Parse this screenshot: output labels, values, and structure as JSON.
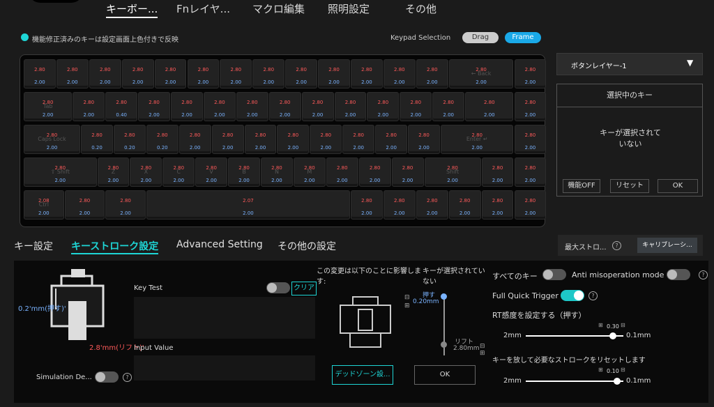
{
  "tabs": [
    "キーボー...",
    "Fnレイヤ...",
    "マクロ編集",
    "照明設定",
    "その他"
  ],
  "notice": "機能修正済みのキーは設定画面上色付きで反映",
  "keypad_selection": {
    "label": "Keypad Selection",
    "drag": "Drag",
    "frame": "Frame"
  },
  "keys": {
    "rows": [
      [
        {
          "a": "2.80",
          "b": "2.00"
        },
        {
          "a": "2.80",
          "b": "2.00"
        },
        {
          "a": "2.80",
          "b": "2.00"
        },
        {
          "a": "2.80",
          "b": "2.00"
        },
        {
          "a": "2.80",
          "b": "2.00"
        },
        {
          "a": "2.80",
          "b": "2.00"
        },
        {
          "a": "2.80",
          "b": "2.00"
        },
        {
          "a": "2.80",
          "b": "2.00"
        },
        {
          "a": "2.80",
          "b": "2.00"
        },
        {
          "a": "2.80",
          "b": "2.00"
        },
        {
          "a": "2.80",
          "b": "2.00"
        },
        {
          "a": "2.80",
          "b": "2.00"
        },
        {
          "a": "2.80",
          "b": "2.00"
        },
        {
          "a": "2.80",
          "b": "2.00",
          "l": "← Back"
        },
        {
          "a": "2.80",
          "b": "2.00"
        }
      ],
      [
        {
          "a": "2.80",
          "b": "2.00",
          "l": "Tab"
        },
        {
          "a": "2.80",
          "b": "2.00"
        },
        {
          "a": "2.80",
          "b": "0.40"
        },
        {
          "a": "2.80",
          "b": "2.00"
        },
        {
          "a": "2.80",
          "b": "2.00"
        },
        {
          "a": "2.80",
          "b": "2.00"
        },
        {
          "a": "2.80",
          "b": "2.00"
        },
        {
          "a": "2.80",
          "b": "2.00"
        },
        {
          "a": "2.80",
          "b": "2.00"
        },
        {
          "a": "2.80",
          "b": "2.00"
        },
        {
          "a": "2.80",
          "b": "2.00"
        },
        {
          "a": "2.80",
          "b": "2.00"
        },
        {
          "a": "2.80",
          "b": "2.00"
        },
        {
          "a": "2.80",
          "b": "2.00"
        },
        {
          "a": "2.80",
          "b": "2.00"
        }
      ],
      [
        {
          "a": "2.80",
          "b": "2.00",
          "l": "Caps Lock"
        },
        {
          "a": "2.80",
          "b": "0.20"
        },
        {
          "a": "2.80",
          "b": "0.20"
        },
        {
          "a": "2.80",
          "b": "0.20"
        },
        {
          "a": "2.80",
          "b": "2.00"
        },
        {
          "a": "2.80",
          "b": "2.00"
        },
        {
          "a": "2.80",
          "b": "2.00"
        },
        {
          "a": "2.80",
          "b": "2.00"
        },
        {
          "a": "2.80",
          "b": "2.00"
        },
        {
          "a": "2.80",
          "b": "2.00"
        },
        {
          "a": "2.80",
          "b": "2.00"
        },
        {
          "a": "2.80",
          "b": "2.00"
        },
        {
          "a": "2.80",
          "b": "2.00",
          "l": "Enter ↵"
        },
        {
          "a": "2.80",
          "b": "2.00"
        }
      ],
      [
        {
          "a": "2.80",
          "b": "2.00",
          "l": "⇧ Shift"
        },
        {
          "a": "2.80",
          "b": "2.00",
          "l": "Z"
        },
        {
          "a": "2.80",
          "b": "2.00",
          "l": "X"
        },
        {
          "a": "2.80",
          "b": "2.00",
          "l": "C"
        },
        {
          "a": "2.80",
          "b": "2.00",
          "l": "V"
        },
        {
          "a": "2.80",
          "b": "2.00",
          "l": "B"
        },
        {
          "a": "2.80",
          "b": "2.00",
          "l": "N"
        },
        {
          "a": "2.80",
          "b": "2.00",
          "l": "M"
        },
        {
          "a": "2.80",
          "b": "2.00"
        },
        {
          "a": "2.80",
          "b": "2.00"
        },
        {
          "a": "2.80",
          "b": "2.00"
        },
        {
          "a": "2.80",
          "b": "2.00",
          "l": "Shift"
        },
        {
          "a": "2.80",
          "b": "2.00"
        },
        {
          "a": "2.80",
          "b": "2.00"
        }
      ],
      [
        {
          "a": "2.08",
          "b": "2.00",
          "l": "Ctrl"
        },
        {
          "a": "2.80",
          "b": "2.00"
        },
        {
          "a": "2.80",
          "b": "2.00"
        },
        {
          "a": "2.07",
          "b": "2.00"
        },
        {
          "a": "2.80",
          "b": "2.00"
        },
        {
          "a": "2.80",
          "b": "2.00"
        },
        {
          "a": "2.80",
          "b": "2.00"
        },
        {
          "a": "2.80",
          "b": "2.00"
        },
        {
          "a": "2.80",
          "b": "2.00"
        },
        {
          "a": "2.80",
          "b": "2.00"
        }
      ]
    ]
  },
  "right_panel": {
    "layer_select": "ボタンレイヤー-1",
    "selected_title": "選択中のキー",
    "no_key": "キーが選択されていない",
    "func_off": "機能OFF",
    "reset": "リセット",
    "ok": "OK"
  },
  "subtabs": [
    "キー設定",
    "キーストローク設定",
    "Advanced Setting",
    "その他の設定"
  ],
  "max_stroke": "最大ストロ...",
  "calibration": "キャリブレーシ...",
  "left": {
    "press_label": "0.2'mm(押す)'",
    "lift_label": "2.8'mm(リフト)'",
    "simulation": "Simulation De..."
  },
  "key_test": {
    "label": "Key Test",
    "clear": "クリア",
    "input_value": "Input Value"
  },
  "middle": {
    "impact_text": "この変更は以下のことに影響します:",
    "no_key": "キーが選択されていない",
    "press": "押す",
    "press_val": "0.20mm",
    "lift": "リフト",
    "lift_val": "2.80mm",
    "deadzone": "デッドゾーン設...",
    "ok": "OK"
  },
  "settings": {
    "all_keys": "すべてのキー",
    "anti_mis": "Anti misoperation mode",
    "fqt": "Full Quick Trigger",
    "rt_label": "RT感度を設定する（押す）",
    "rt_min": "2mm",
    "rt_val": "0.30",
    "rt_max": "0.1mm",
    "release_label": "キーを放して必要なストロークをリセットします",
    "rel_min": "2mm",
    "rel_val": "0.10",
    "rel_max": "0.1mm"
  },
  "colors": {
    "accent": "#1ed6d6",
    "red": "#ff5a5a",
    "blue": "#7ab3ff"
  }
}
